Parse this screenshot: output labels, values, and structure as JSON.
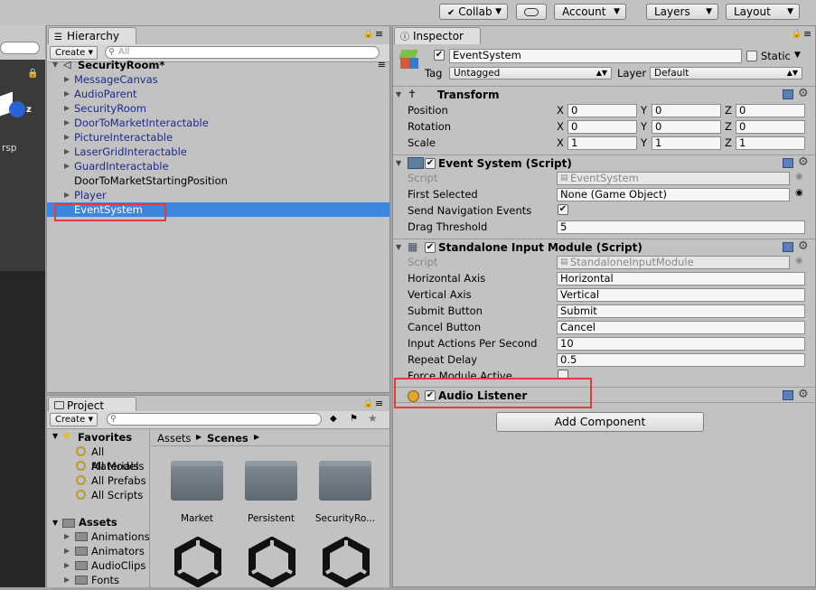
{
  "toolbar": {
    "collab": "Collab",
    "account": "Account",
    "layers": "Layers",
    "layout": "Layout"
  },
  "scene": {
    "axis_z": "z",
    "persp": "rsp"
  },
  "hierarchy": {
    "tab": "Hierarchy",
    "create": "Create",
    "search_placeholder": "All",
    "scene_name": "SecurityRoom*",
    "items": [
      {
        "label": "MessageCanvas",
        "expandable": true,
        "prefab": true
      },
      {
        "label": "AudioParent",
        "expandable": true,
        "prefab": true
      },
      {
        "label": "SecurityRoom",
        "expandable": true,
        "prefab": true
      },
      {
        "label": "DoorToMarketInteractable",
        "expandable": true,
        "prefab": true
      },
      {
        "label": "PictureInteractable",
        "expandable": true,
        "prefab": true
      },
      {
        "label": "LaserGridInteractable",
        "expandable": true,
        "prefab": true
      },
      {
        "label": "GuardInteractable",
        "expandable": true,
        "prefab": true
      },
      {
        "label": "DoorToMarketStartingPosition",
        "expandable": false,
        "prefab": false
      },
      {
        "label": "Player",
        "expandable": true,
        "prefab": true
      },
      {
        "label": "EventSystem",
        "expandable": false,
        "prefab": false,
        "selected": true
      }
    ]
  },
  "project": {
    "tab": "Project",
    "create": "Create",
    "favorites_label": "Favorites",
    "favorites": [
      "All Materials",
      "All Models",
      "All Prefabs",
      "All Scripts"
    ],
    "assets_label": "Assets",
    "asset_folders": [
      "Animations",
      "Animators",
      "AudioClips",
      "Fonts"
    ],
    "breadcrumb_root": "Assets",
    "breadcrumb_current": "Scenes",
    "grid_items": [
      "Market",
      "Persistent",
      "SecurityRo..."
    ]
  },
  "inspector": {
    "tab": "Inspector",
    "object_name": "EventSystem",
    "static_label": "Static",
    "tag_label": "Tag",
    "tag_value": "Untagged",
    "layer_label": "Layer",
    "layer_value": "Default",
    "transform": {
      "title": "Transform",
      "position_label": "Position",
      "rotation_label": "Rotation",
      "scale_label": "Scale",
      "position": [
        "0",
        "0",
        "0"
      ],
      "rotation": [
        "0",
        "0",
        "0"
      ],
      "scale": [
        "1",
        "1",
        "1"
      ],
      "axis": [
        "X",
        "Y",
        "Z"
      ]
    },
    "event_system": {
      "title": "Event System (Script)",
      "script_label": "Script",
      "script_value": "EventSystem",
      "first_selected_label": "First Selected",
      "first_selected_value": "None (Game Object)",
      "send_nav_label": "Send Navigation Events",
      "drag_threshold_label": "Drag Threshold",
      "drag_threshold_value": "5"
    },
    "standalone": {
      "title": "Standalone Input Module (Script)",
      "script_label": "Script",
      "script_value": "StandaloneInputModule",
      "horizontal_label": "Horizontal Axis",
      "horizontal_value": "Horizontal",
      "vertical_label": "Vertical Axis",
      "vertical_value": "Vertical",
      "submit_label": "Submit Button",
      "submit_value": "Submit",
      "cancel_label": "Cancel Button",
      "cancel_value": "Cancel",
      "ips_label": "Input Actions Per Second",
      "ips_value": "10",
      "repeat_label": "Repeat Delay",
      "repeat_value": "0.5",
      "force_label": "Force Module Active"
    },
    "audio_listener": {
      "title": "Audio Listener"
    },
    "add_component": "Add Component"
  },
  "colors": {
    "selection": "#3d86de",
    "highlight_box": "#e23b3b",
    "prefab_text": "#1b2c8c"
  }
}
